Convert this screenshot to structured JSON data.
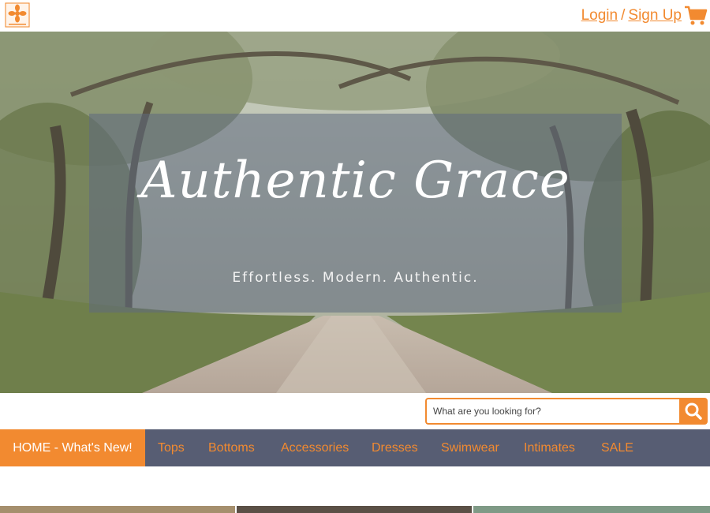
{
  "header": {
    "login": "Login",
    "separator": "/",
    "signup": "Sign Up",
    "logo_icon": "floral-tile-logo-icon",
    "cart_icon": "shopping-cart-icon"
  },
  "hero": {
    "title": "Authentic Grace",
    "tagline": "Effortless. Modern. Authentic."
  },
  "search": {
    "placeholder": "What are you looking for?",
    "icon": "search-icon"
  },
  "nav": {
    "home": "HOME - What's New!",
    "items": [
      "Tops",
      "Bottoms",
      "Accessories",
      "Dresses",
      "Swimwear",
      "Intimates",
      "SALE"
    ]
  },
  "colors": {
    "accent": "#f28a30",
    "nav_bg": "#575d73",
    "overlay": "#5f6980"
  }
}
